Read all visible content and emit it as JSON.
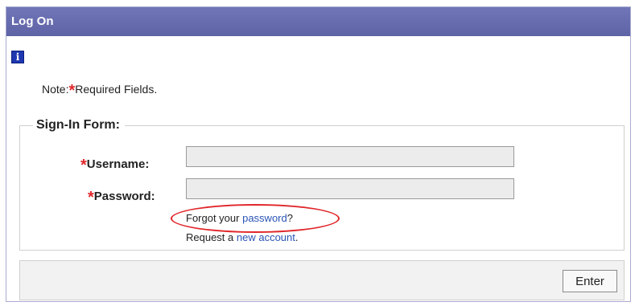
{
  "window": {
    "title": "Log On"
  },
  "note": {
    "prefix": "Note:",
    "required_marker": "*",
    "text": "Required Fields."
  },
  "form": {
    "legend": "Sign-In Form:",
    "username": {
      "required_marker": "*",
      "label": "Username:",
      "value": ""
    },
    "password": {
      "required_marker": "*",
      "label": "Password:",
      "value": ""
    },
    "forgot": {
      "prefix": "Forgot your ",
      "link": "password",
      "suffix": "?"
    },
    "request": {
      "prefix": "Request a ",
      "link": "new account",
      "suffix": "."
    }
  },
  "footer": {
    "enter_label": "Enter"
  },
  "colors": {
    "titlebar": "#6569ad",
    "required": "#e0262a",
    "link": "#2a54b5",
    "highlight_circle": "#e0262a"
  },
  "icons": {
    "info": "info-icon"
  }
}
